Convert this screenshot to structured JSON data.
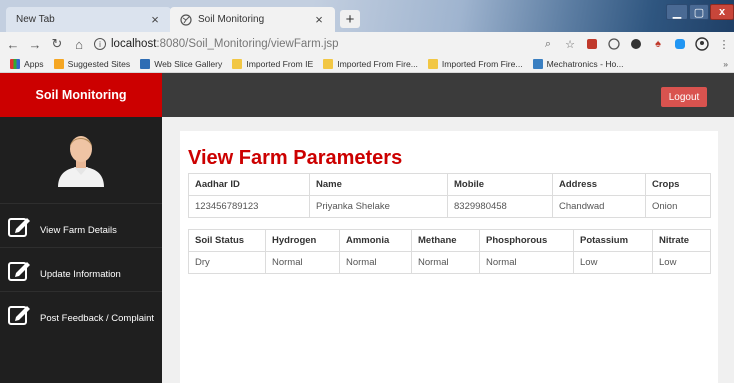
{
  "browser": {
    "tabs": [
      {
        "label": "New Tab",
        "active": false
      },
      {
        "label": "Soil Monitoring",
        "active": true
      }
    ],
    "url_host": "localhost",
    "url_path": ":8080/Soil_Monitoring/viewFarm.jsp",
    "bookmarks": [
      {
        "label": "Apps",
        "icon": "apps-icon"
      },
      {
        "label": "Suggested Sites",
        "icon": "suggested-sites-icon"
      },
      {
        "label": "Web Slice Gallery",
        "icon": "web-slice-icon"
      },
      {
        "label": "Imported From IE",
        "icon": "folder-icon"
      },
      {
        "label": "Imported From Fire...",
        "icon": "folder-icon"
      },
      {
        "label": "Imported From Fire...",
        "icon": "folder-icon"
      },
      {
        "label": "Mechatronics - Ho...",
        "icon": "mechatronics-icon"
      }
    ],
    "bookmarks_overflow": "»"
  },
  "app": {
    "brand": "Soil Monitoring",
    "logout_label": "Logout",
    "menu": [
      {
        "label": "View Farm Details",
        "icon": "edit-icon"
      },
      {
        "label": "Update Information",
        "icon": "edit-icon"
      },
      {
        "label": "Post Feedback / Complaint",
        "icon": "edit-icon"
      }
    ],
    "page_title": "View Farm Parameters",
    "farmer_table": {
      "headers": [
        "Aadhar ID",
        "Name",
        "Mobile",
        "Address",
        "Crops"
      ],
      "rows": [
        [
          "123456789123",
          "Priyanka Shelake",
          "8329980458",
          "Chandwad",
          "Onion"
        ]
      ]
    },
    "soil_table": {
      "headers": [
        "Soil Status",
        "Hydrogen",
        "Ammonia",
        "Methane",
        "Phosphorous",
        "Potassium",
        "Nitrate"
      ],
      "rows": [
        [
          "Dry",
          "Normal",
          "Normal",
          "Normal",
          "Normal",
          "Low",
          "Low"
        ]
      ]
    }
  },
  "colors": {
    "brand_red": "#cc0000",
    "topbar": "#3b3b3b",
    "sidebar": "#1f1f1f",
    "logout": "#d9534f"
  }
}
